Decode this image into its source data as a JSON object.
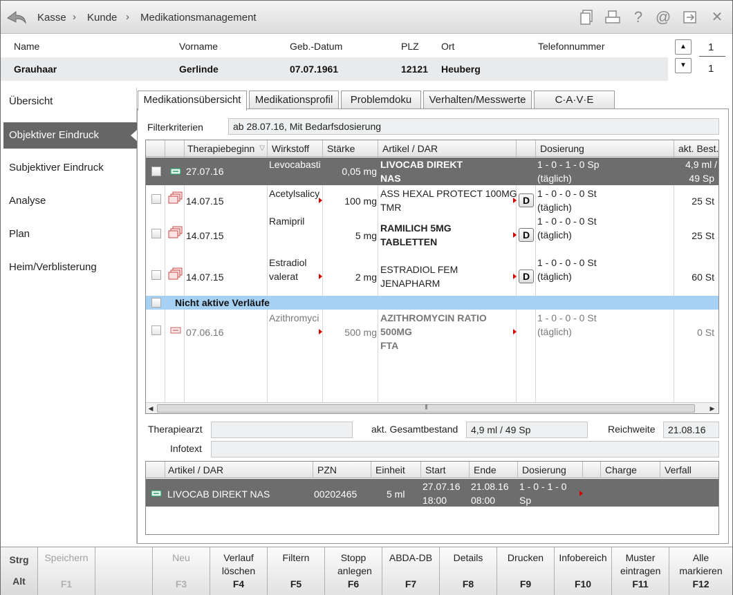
{
  "breadcrumb": {
    "items": [
      "Kasse",
      "Kunde",
      "Medikationsmanagement"
    ],
    "separator": "›"
  },
  "toolbar": {
    "icons": [
      "copy-icon",
      "print-icon",
      "help-icon",
      "email-icon",
      "exit-icon",
      "close-icon"
    ],
    "help_glyph": "?",
    "email_glyph": "@",
    "close_glyph": "✕"
  },
  "customer": {
    "labels": {
      "name": "Name",
      "vorname": "Vorname",
      "geb": "Geb.-Datum",
      "plz": "PLZ",
      "ort": "Ort",
      "telefon": "Telefonnummer"
    },
    "values": {
      "name": "Grauhaar",
      "vorname": "Gerlinde",
      "geb": "07.07.1961",
      "plz": "12121",
      "ort": "Heuberg",
      "telefon": ""
    },
    "counter_top": "1",
    "counter_bottom": "1"
  },
  "sidebar": {
    "items": [
      {
        "label": "Übersicht",
        "active": false
      },
      {
        "label": "Objektiver Eindruck",
        "active": true
      },
      {
        "label": "Subjektiver Eindruck",
        "active": false
      },
      {
        "label": "Analyse",
        "active": false
      },
      {
        "label": "Plan",
        "active": false
      },
      {
        "label": "Heim/Verblisterung",
        "active": false
      }
    ]
  },
  "tabs": [
    {
      "label": "Medikationsübersicht",
      "active": true
    },
    {
      "label": "Medikationsprofil",
      "active": false
    },
    {
      "label": "Problemdoku",
      "active": false
    },
    {
      "label": "Verhalten/Messwerte",
      "active": false
    },
    {
      "label": "C·A·V·E",
      "active": false
    }
  ],
  "filter": {
    "label": "Filterkriterien",
    "value": "ab 28.07.16, Mit Bedarfsdosierung"
  },
  "grid": {
    "columns": [
      "Therapiebeginn",
      "Wirkstoff",
      "Stärke",
      "Artikel / DAR",
      "",
      "Dosierung",
      "akt. Best."
    ],
    "sort_glyph": "▽",
    "rows": [
      {
        "date": "27.07.16",
        "wirkstoff": [
          "Levocabasti"
        ],
        "staerke": "0,05 mg",
        "artikel": [
          "LIVOCAB DIREKT",
          "NAS"
        ],
        "artikel_bold": true,
        "d": "",
        "dosierung": [
          "1 - 0 - 1 - 0 Sp",
          "(täglich)"
        ],
        "bestand": [
          "4,9 ml /",
          "49 Sp"
        ],
        "selected": true
      },
      {
        "date": "14.07.15",
        "wirkstoff": [
          "Acetylsalicy"
        ],
        "staerke": "100 mg",
        "artikel": [
          "ASS HEXAL PROTECT 100MG",
          "TMR"
        ],
        "artikel_bold": false,
        "d": "D",
        "dosierung": [
          "1 - 0 - 0 - 0 St",
          "(täglich)"
        ],
        "bestand": [
          "25 St"
        ],
        "selected": false
      },
      {
        "date": "14.07.15",
        "wirkstoff": [
          "Ramipril"
        ],
        "staerke": "5 mg",
        "artikel": [
          "RAMILICH 5MG",
          "TABLETTEN"
        ],
        "artikel_bold": true,
        "d": "D",
        "dosierung": [
          "1 - 0 - 0 - 0 St",
          "(täglich)"
        ],
        "bestand": [
          "25 St"
        ],
        "selected": false
      },
      {
        "date": "14.07.15",
        "wirkstoff": [
          "Estradiol",
          "valerat"
        ],
        "staerke": "2 mg",
        "artikel": [
          "ESTRADIOL FEM",
          "JENAPHARM"
        ],
        "artikel_bold": false,
        "d": "D",
        "dosierung": [
          "1 - 0 - 0 - 0 St",
          "(täglich)"
        ],
        "bestand": [
          "60 St"
        ],
        "selected": false
      }
    ],
    "group_label": "Nicht aktive Verläufe",
    "inactive_rows": [
      {
        "date": "07.06.16",
        "wirkstoff": [
          "Azithromyci"
        ],
        "staerke": "500 mg",
        "artikel": [
          "AZITHROMYCIN RATIO",
          "500MG",
          "FTA"
        ],
        "dosierung": [
          "1 - 0 - 0 - 0 St",
          "(täglich)"
        ],
        "bestand": [
          "0 St"
        ]
      }
    ],
    "scroll_grip": "|||"
  },
  "details": {
    "therapiearzt_label": "Therapiearzt",
    "therapiearzt_value": "",
    "gesamtbestand_label": "akt. Gesamtbestand",
    "gesamtbestand_value": "4,9 ml / 49 Sp",
    "reichweite_label": "Reichweite",
    "reichweite_value": "21.08.16",
    "infotext_label": "Infotext",
    "infotext_value": ""
  },
  "bottom_grid": {
    "columns": [
      "Artikel / DAR",
      "PZN",
      "Einheit",
      "Start",
      "Ende",
      "Dosierung",
      "",
      "Charge",
      "Verfall"
    ],
    "rows": [
      {
        "artikel": "LIVOCAB DIREKT NAS",
        "pzn": "00202465",
        "einheit": "5 ml",
        "start": [
          "27.07.16",
          "18:00"
        ],
        "ende": [
          "21.08.16",
          "08:00"
        ],
        "dosierung": [
          "1 - 0 - 1 - 0",
          "Sp"
        ],
        "charge": "",
        "verfall": ""
      }
    ]
  },
  "fkeys": {
    "modifiers": [
      "Strg",
      "Alt"
    ],
    "keys": [
      {
        "label": "Speichern",
        "key": "F1",
        "enabled": false
      },
      {
        "label": "",
        "key": "",
        "enabled": false
      },
      {
        "label": "Neu",
        "key": "F3",
        "enabled": false
      },
      {
        "label": "Verlauf löschen",
        "key": "F4",
        "enabled": true
      },
      {
        "label": "Filtern",
        "key": "F5",
        "enabled": true
      },
      {
        "label": "Stopp anlegen",
        "key": "F6",
        "enabled": true
      },
      {
        "label": "ABDA-DB",
        "key": "F7",
        "enabled": true
      },
      {
        "label": "Details",
        "key": "F8",
        "enabled": true
      },
      {
        "label": "Drucken",
        "key": "F9",
        "enabled": true
      },
      {
        "label": "Infobereich",
        "key": "F10",
        "enabled": true
      },
      {
        "label": "Muster eintragen",
        "key": "F11",
        "enabled": true
      },
      {
        "label": "Alle markieren",
        "key": "F12",
        "enabled": true
      }
    ]
  },
  "colors": {
    "selected_row": "#6d6d6d",
    "group_row": "#a7d1f3",
    "active_sidebar": "#666666",
    "red_marker": "#d40000"
  }
}
